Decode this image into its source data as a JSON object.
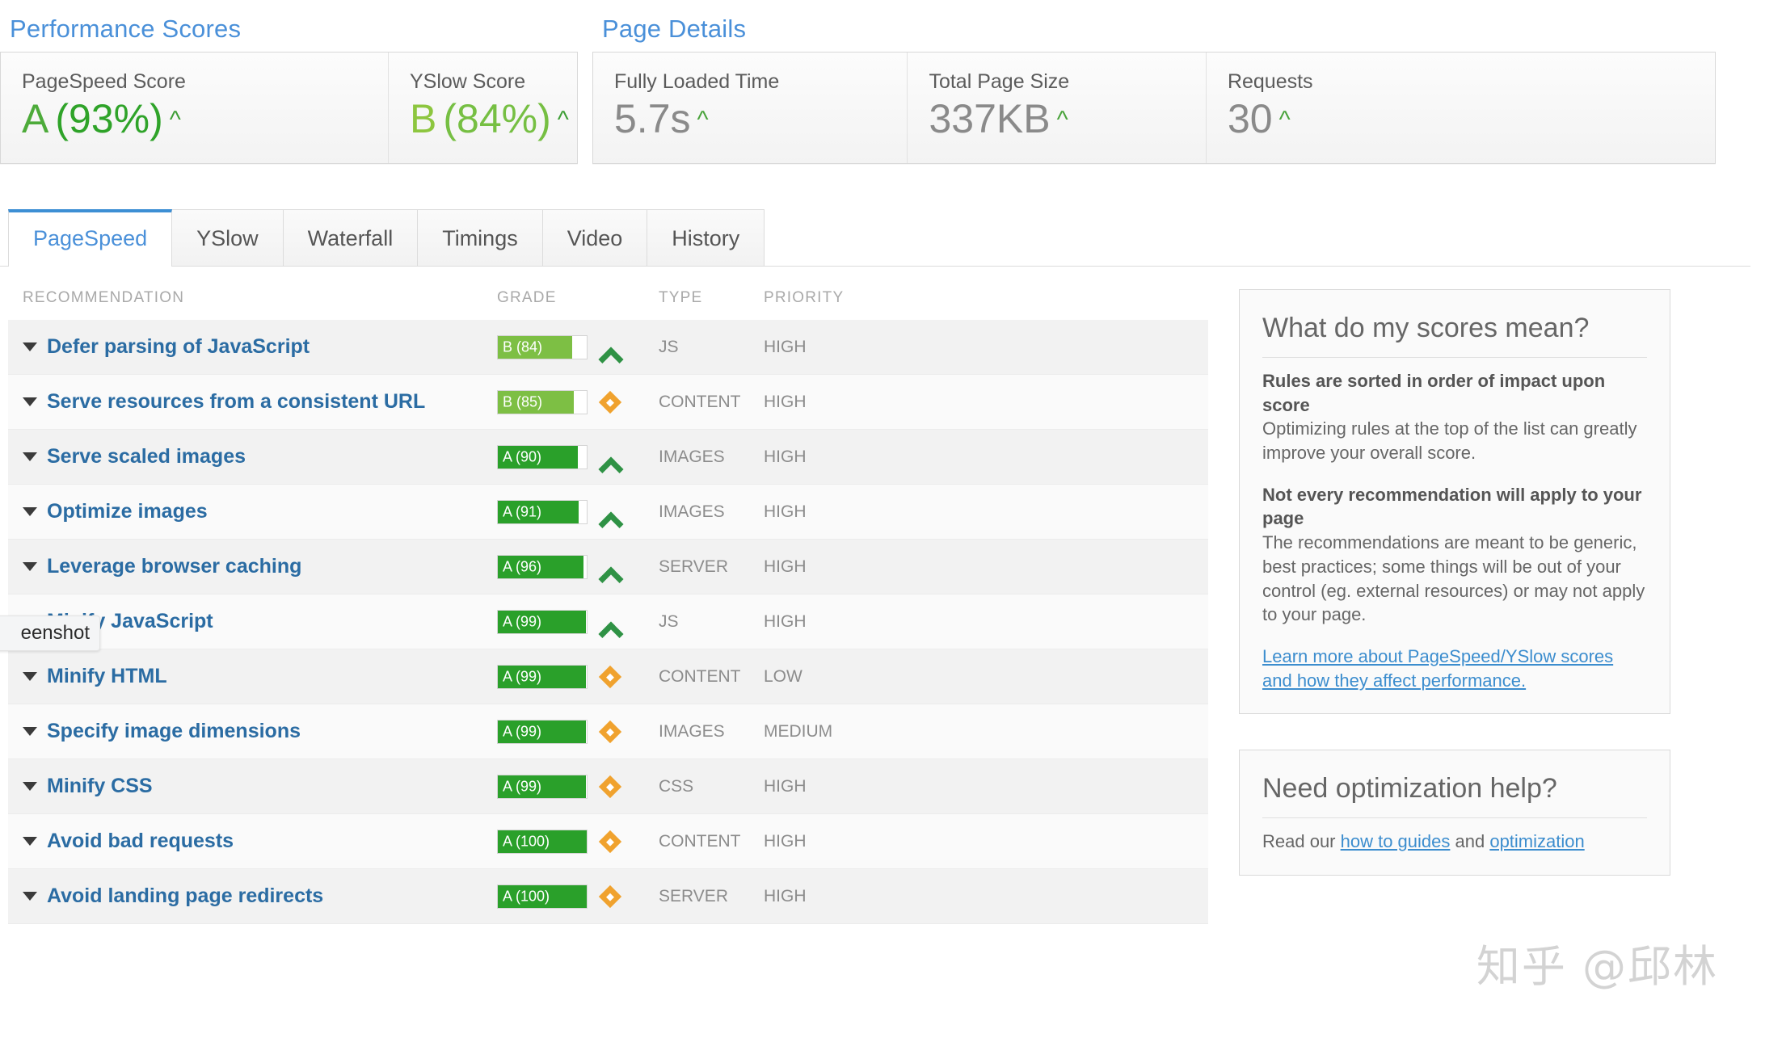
{
  "performance": {
    "title": "Performance Scores",
    "cards": [
      {
        "label": "PageSpeed Score",
        "grade": "A",
        "percent": "(93%)",
        "trend": "caret-up-icon"
      },
      {
        "label": "YSlow Score",
        "grade": "B",
        "percent": "(84%)",
        "trend": "caret-up-icon"
      }
    ]
  },
  "page_details": {
    "title": "Page Details",
    "cards": [
      {
        "label": "Fully Loaded Time",
        "value": "5.7s",
        "trend": "caret-up-icon"
      },
      {
        "label": "Total Page Size",
        "value": "337KB",
        "trend": "caret-up-icon"
      },
      {
        "label": "Requests",
        "value": "30",
        "trend": "caret-up-icon"
      }
    ]
  },
  "tabs": [
    {
      "label": "PageSpeed",
      "active": true
    },
    {
      "label": "YSlow",
      "active": false
    },
    {
      "label": "Waterfall",
      "active": false
    },
    {
      "label": "Timings",
      "active": false
    },
    {
      "label": "Video",
      "active": false
    },
    {
      "label": "History",
      "active": false
    }
  ],
  "table": {
    "headers": {
      "recommendation": "RECOMMENDATION",
      "grade": "GRADE",
      "type": "TYPE",
      "priority": "PRIORITY"
    },
    "rows": [
      {
        "recommendation": "Defer parsing of JavaScript",
        "grade": "B (84)",
        "score": 84,
        "grade_letter": "B",
        "impact_icon": "chevron-up-icon",
        "type": "JS",
        "priority": "HIGH"
      },
      {
        "recommendation": "Serve resources from a consistent URL",
        "grade": "B (85)",
        "score": 85,
        "grade_letter": "B",
        "impact_icon": "diamond-icon",
        "type": "CONTENT",
        "priority": "HIGH"
      },
      {
        "recommendation": "Serve scaled images",
        "grade": "A (90)",
        "score": 90,
        "grade_letter": "A",
        "impact_icon": "chevron-up-icon",
        "type": "IMAGES",
        "priority": "HIGH"
      },
      {
        "recommendation": "Optimize images",
        "grade": "A (91)",
        "score": 91,
        "grade_letter": "A",
        "impact_icon": "chevron-up-icon",
        "type": "IMAGES",
        "priority": "HIGH"
      },
      {
        "recommendation": "Leverage browser caching",
        "grade": "A (96)",
        "score": 96,
        "grade_letter": "A",
        "impact_icon": "chevron-up-icon",
        "type": "SERVER",
        "priority": "HIGH"
      },
      {
        "recommendation": "Minify JavaScript",
        "grade": "A (99)",
        "score": 99,
        "grade_letter": "A",
        "impact_icon": "chevron-up-icon",
        "type": "JS",
        "priority": "HIGH"
      },
      {
        "recommendation": "Minify HTML",
        "grade": "A (99)",
        "score": 99,
        "grade_letter": "A",
        "impact_icon": "diamond-icon",
        "type": "CONTENT",
        "priority": "LOW"
      },
      {
        "recommendation": "Specify image dimensions",
        "grade": "A (99)",
        "score": 99,
        "grade_letter": "A",
        "impact_icon": "diamond-icon",
        "type": "IMAGES",
        "priority": "MEDIUM"
      },
      {
        "recommendation": "Minify CSS",
        "grade": "A (99)",
        "score": 99,
        "grade_letter": "A",
        "impact_icon": "diamond-icon",
        "type": "CSS",
        "priority": "HIGH"
      },
      {
        "recommendation": "Avoid bad requests",
        "grade": "A (100)",
        "score": 100,
        "grade_letter": "A",
        "impact_icon": "diamond-icon",
        "type": "CONTENT",
        "priority": "HIGH"
      },
      {
        "recommendation": "Avoid landing page redirects",
        "grade": "A (100)",
        "score": 100,
        "grade_letter": "A",
        "impact_icon": "diamond-icon",
        "type": "SERVER",
        "priority": "HIGH"
      }
    ]
  },
  "sidebar": {
    "scores_card": {
      "heading": "What do my scores mean?",
      "block1_title": "Rules are sorted in order of impact upon score",
      "block1_body": "Optimizing rules at the top of the list can greatly improve your overall score.",
      "block2_title": "Not every recommendation will apply to your page",
      "block2_body": "The recommendations are meant to be generic, best practices; some things will be out of your control (eg. external resources) or may not apply to your page.",
      "link": "Learn more about PageSpeed/YSlow scores and how they affect performance."
    },
    "help_card": {
      "heading": "Need optimization help?",
      "body_prefix": "Read our ",
      "link1": "how to guides",
      "body_mid": " and ",
      "link2": "optimization"
    }
  },
  "overlay": {
    "tooltip_text": "eenshot",
    "watermark": "知乎 @邱林"
  },
  "colors": {
    "accent_blue": "#4a90d9",
    "link_blue": "#2b6ca3",
    "grade_a_green": "#2aa02a",
    "grade_b_green": "#7dbf44",
    "diamond_orange": "#f0a22e",
    "chevron_green": "#2f9245"
  }
}
